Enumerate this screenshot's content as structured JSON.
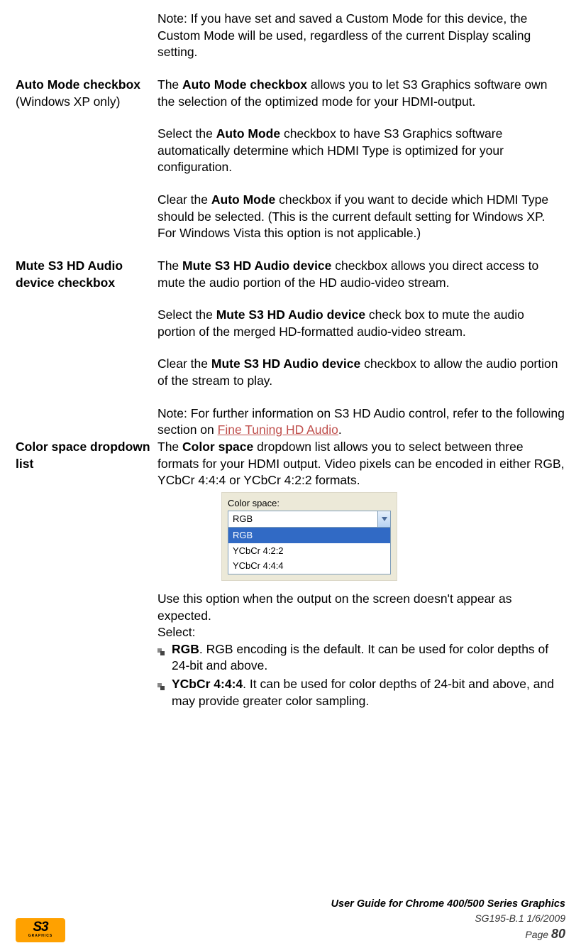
{
  "sections": {
    "intro_note": "Note: If you have set and saved a Custom Mode for this device, the Custom Mode will be used, regardless of the current Display scaling setting.",
    "auto_mode": {
      "label_bold": "Auto Mode checkbox",
      "label_reg": "(Windows XP only)",
      "p1_pre": "The ",
      "p1_bold": "Auto Mode checkbox",
      "p1_post": " allows you to let S3 Graphics software own the selection of the optimized mode for your HDMI-output.",
      "p2_pre": "Select the ",
      "p2_bold": "Auto Mode",
      "p2_post": " checkbox to have S3 Graphics software automatically determine which HDMI Type is optimized for your configuration.",
      "p3_pre": "Clear the ",
      "p3_bold": "Auto Mode",
      "p3_post": " checkbox if you want to decide which HDMI Type should be selected. (This is the current default setting for Windows XP. For Windows Vista this option is not applicable.)"
    },
    "mute": {
      "label_bold": "Mute S3 HD Audio device checkbox",
      "p1_pre": "The ",
      "p1_bold": "Mute S3 HD Audio device",
      "p1_post": " checkbox allows you direct access to mute the audio portion of the HD audio-video stream.",
      "p2_pre": "Select the ",
      "p2_bold": "Mute S3 HD Audio device",
      "p2_post": " check box to mute the audio portion of the merged HD-formatted audio-video stream.",
      "p3_pre": "Clear the ",
      "p3_bold": "Mute S3 HD Audio device",
      "p3_post": " checkbox to allow the audio portion of the stream to play.",
      "p4_pre": "Note: For further information on S3 HD Audio control, refer to the following section on ",
      "p4_link": "Fine Tuning HD Audio",
      "p4_post": "."
    },
    "color_space": {
      "label_bold": "Color space dropdown list",
      "p1_pre": "The ",
      "p1_bold": "Color space",
      "p1_post": " dropdown list allows you to select between three formats for your HDMI output. Video pixels can be encoded in either RGB, YCbCr 4:4:4 or YCbCr 4:2:2 formats.",
      "dropdown": {
        "title": "Color space:",
        "selected": "RGB",
        "options": [
          "RGB",
          "YCbCr 4:2:2",
          "YCbCr 4:4:4"
        ]
      },
      "p2": "Use this option when the output on the screen doesn't appear as expected.",
      "p3": "Select:",
      "bullets": [
        {
          "bold": "RGB",
          "text": ". RGB encoding is the default. It can be used for color depths of 24-bit and above."
        },
        {
          "bold": "YCbCr 4:4:4",
          "text": ". It can be used for color depths of 24-bit and above, and may provide greater color sampling."
        }
      ]
    }
  },
  "footer": {
    "logo_main": "S3",
    "logo_sub": "GRAPHICS",
    "line1": "User Guide for Chrome 400/500 Series Graphics",
    "line2": "SG195-B.1   1/6/2009",
    "page_label": "Page ",
    "page_num": "80"
  }
}
